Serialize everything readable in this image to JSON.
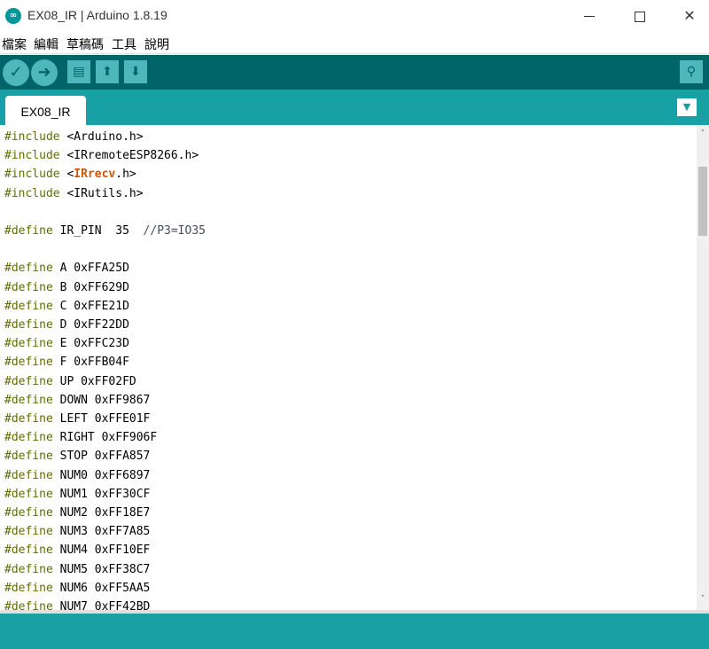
{
  "window": {
    "title": "EX08_IR | Arduino 1.8.19",
    "app_icon_glyph": "∞",
    "minimize_icon": "minimize-icon",
    "maximize_icon": "maximize-icon",
    "close_glyph": "✕"
  },
  "menu": {
    "items": [
      {
        "label": "檔案"
      },
      {
        "label": "編輯"
      },
      {
        "label": "草稿碼"
      },
      {
        "label": "工具"
      },
      {
        "label": "說明"
      }
    ]
  },
  "toolbar": {
    "verify_glyph": "✓",
    "upload_glyph": "➜",
    "new_glyph": "▤",
    "open_glyph": "⬆",
    "save_glyph": "⬇",
    "serial_glyph": "⚲"
  },
  "tabs": {
    "active": "EX08_IR",
    "menu_glyph": "▼"
  },
  "editor": {
    "lines": [
      {
        "parts": [
          {
            "t": "#include",
            "c": "kw"
          },
          {
            "t": " <Arduino.h>",
            "c": ""
          }
        ]
      },
      {
        "parts": [
          {
            "t": "#include",
            "c": "kw"
          },
          {
            "t": " <IRremoteESP8266.h>",
            "c": ""
          }
        ]
      },
      {
        "parts": [
          {
            "t": "#include",
            "c": "kw"
          },
          {
            "t": " <",
            "c": ""
          },
          {
            "t": "IRrecv",
            "c": "lib"
          },
          {
            "t": ".h>",
            "c": ""
          }
        ]
      },
      {
        "parts": [
          {
            "t": "#include",
            "c": "kw"
          },
          {
            "t": " <IRutils.h>",
            "c": ""
          }
        ]
      },
      {
        "parts": []
      },
      {
        "parts": [
          {
            "t": "#define",
            "c": "kw"
          },
          {
            "t": " IR_PIN  35  ",
            "c": ""
          },
          {
            "t": "//P3=IO35",
            "c": "cmt"
          }
        ]
      },
      {
        "parts": []
      },
      {
        "parts": [
          {
            "t": "#define",
            "c": "kw"
          },
          {
            "t": " A 0xFFA25D",
            "c": ""
          }
        ]
      },
      {
        "parts": [
          {
            "t": "#define",
            "c": "kw"
          },
          {
            "t": " B 0xFF629D",
            "c": ""
          }
        ]
      },
      {
        "parts": [
          {
            "t": "#define",
            "c": "kw"
          },
          {
            "t": " C 0xFFE21D",
            "c": ""
          }
        ]
      },
      {
        "parts": [
          {
            "t": "#define",
            "c": "kw"
          },
          {
            "t": " D 0xFF22DD",
            "c": ""
          }
        ]
      },
      {
        "parts": [
          {
            "t": "#define",
            "c": "kw"
          },
          {
            "t": " E 0xFFC23D",
            "c": ""
          }
        ]
      },
      {
        "parts": [
          {
            "t": "#define",
            "c": "kw"
          },
          {
            "t": " F 0xFFB04F",
            "c": ""
          }
        ]
      },
      {
        "parts": [
          {
            "t": "#define",
            "c": "kw"
          },
          {
            "t": " UP 0xFF02FD",
            "c": ""
          }
        ]
      },
      {
        "parts": [
          {
            "t": "#define",
            "c": "kw"
          },
          {
            "t": " DOWN 0xFF9867",
            "c": ""
          }
        ]
      },
      {
        "parts": [
          {
            "t": "#define",
            "c": "kw"
          },
          {
            "t": " LEFT 0xFFE01F",
            "c": ""
          }
        ]
      },
      {
        "parts": [
          {
            "t": "#define",
            "c": "kw"
          },
          {
            "t": " RIGHT 0xFF906F",
            "c": ""
          }
        ]
      },
      {
        "parts": [
          {
            "t": "#define",
            "c": "kw"
          },
          {
            "t": " STOP 0xFFA857",
            "c": ""
          }
        ]
      },
      {
        "parts": [
          {
            "t": "#define",
            "c": "kw"
          },
          {
            "t": " NUM0 0xFF6897",
            "c": ""
          }
        ]
      },
      {
        "parts": [
          {
            "t": "#define",
            "c": "kw"
          },
          {
            "t": " NUM1 0xFF30CF",
            "c": ""
          }
        ]
      },
      {
        "parts": [
          {
            "t": "#define",
            "c": "kw"
          },
          {
            "t": " NUM2 0xFF18E7",
            "c": ""
          }
        ]
      },
      {
        "parts": [
          {
            "t": "#define",
            "c": "kw"
          },
          {
            "t": " NUM3 0xFF7A85",
            "c": ""
          }
        ]
      },
      {
        "parts": [
          {
            "t": "#define",
            "c": "kw"
          },
          {
            "t": " NUM4 0xFF10EF",
            "c": ""
          }
        ]
      },
      {
        "parts": [
          {
            "t": "#define",
            "c": "kw"
          },
          {
            "t": " NUM5 0xFF38C7",
            "c": ""
          }
        ]
      },
      {
        "parts": [
          {
            "t": "#define",
            "c": "kw"
          },
          {
            "t": " NUM6 0xFF5AA5",
            "c": ""
          }
        ]
      },
      {
        "parts": [
          {
            "t": "#define",
            "c": "kw"
          },
          {
            "t": " NUM7 0xFF42BD",
            "c": ""
          }
        ]
      }
    ]
  },
  "scrollbar": {
    "up_glyph": "˄",
    "down_glyph": "˅"
  },
  "colors": {
    "toolbar": "#006468",
    "tabbar": "#17a1a5",
    "keyword": "#5e6d03",
    "library": "#d35400"
  }
}
